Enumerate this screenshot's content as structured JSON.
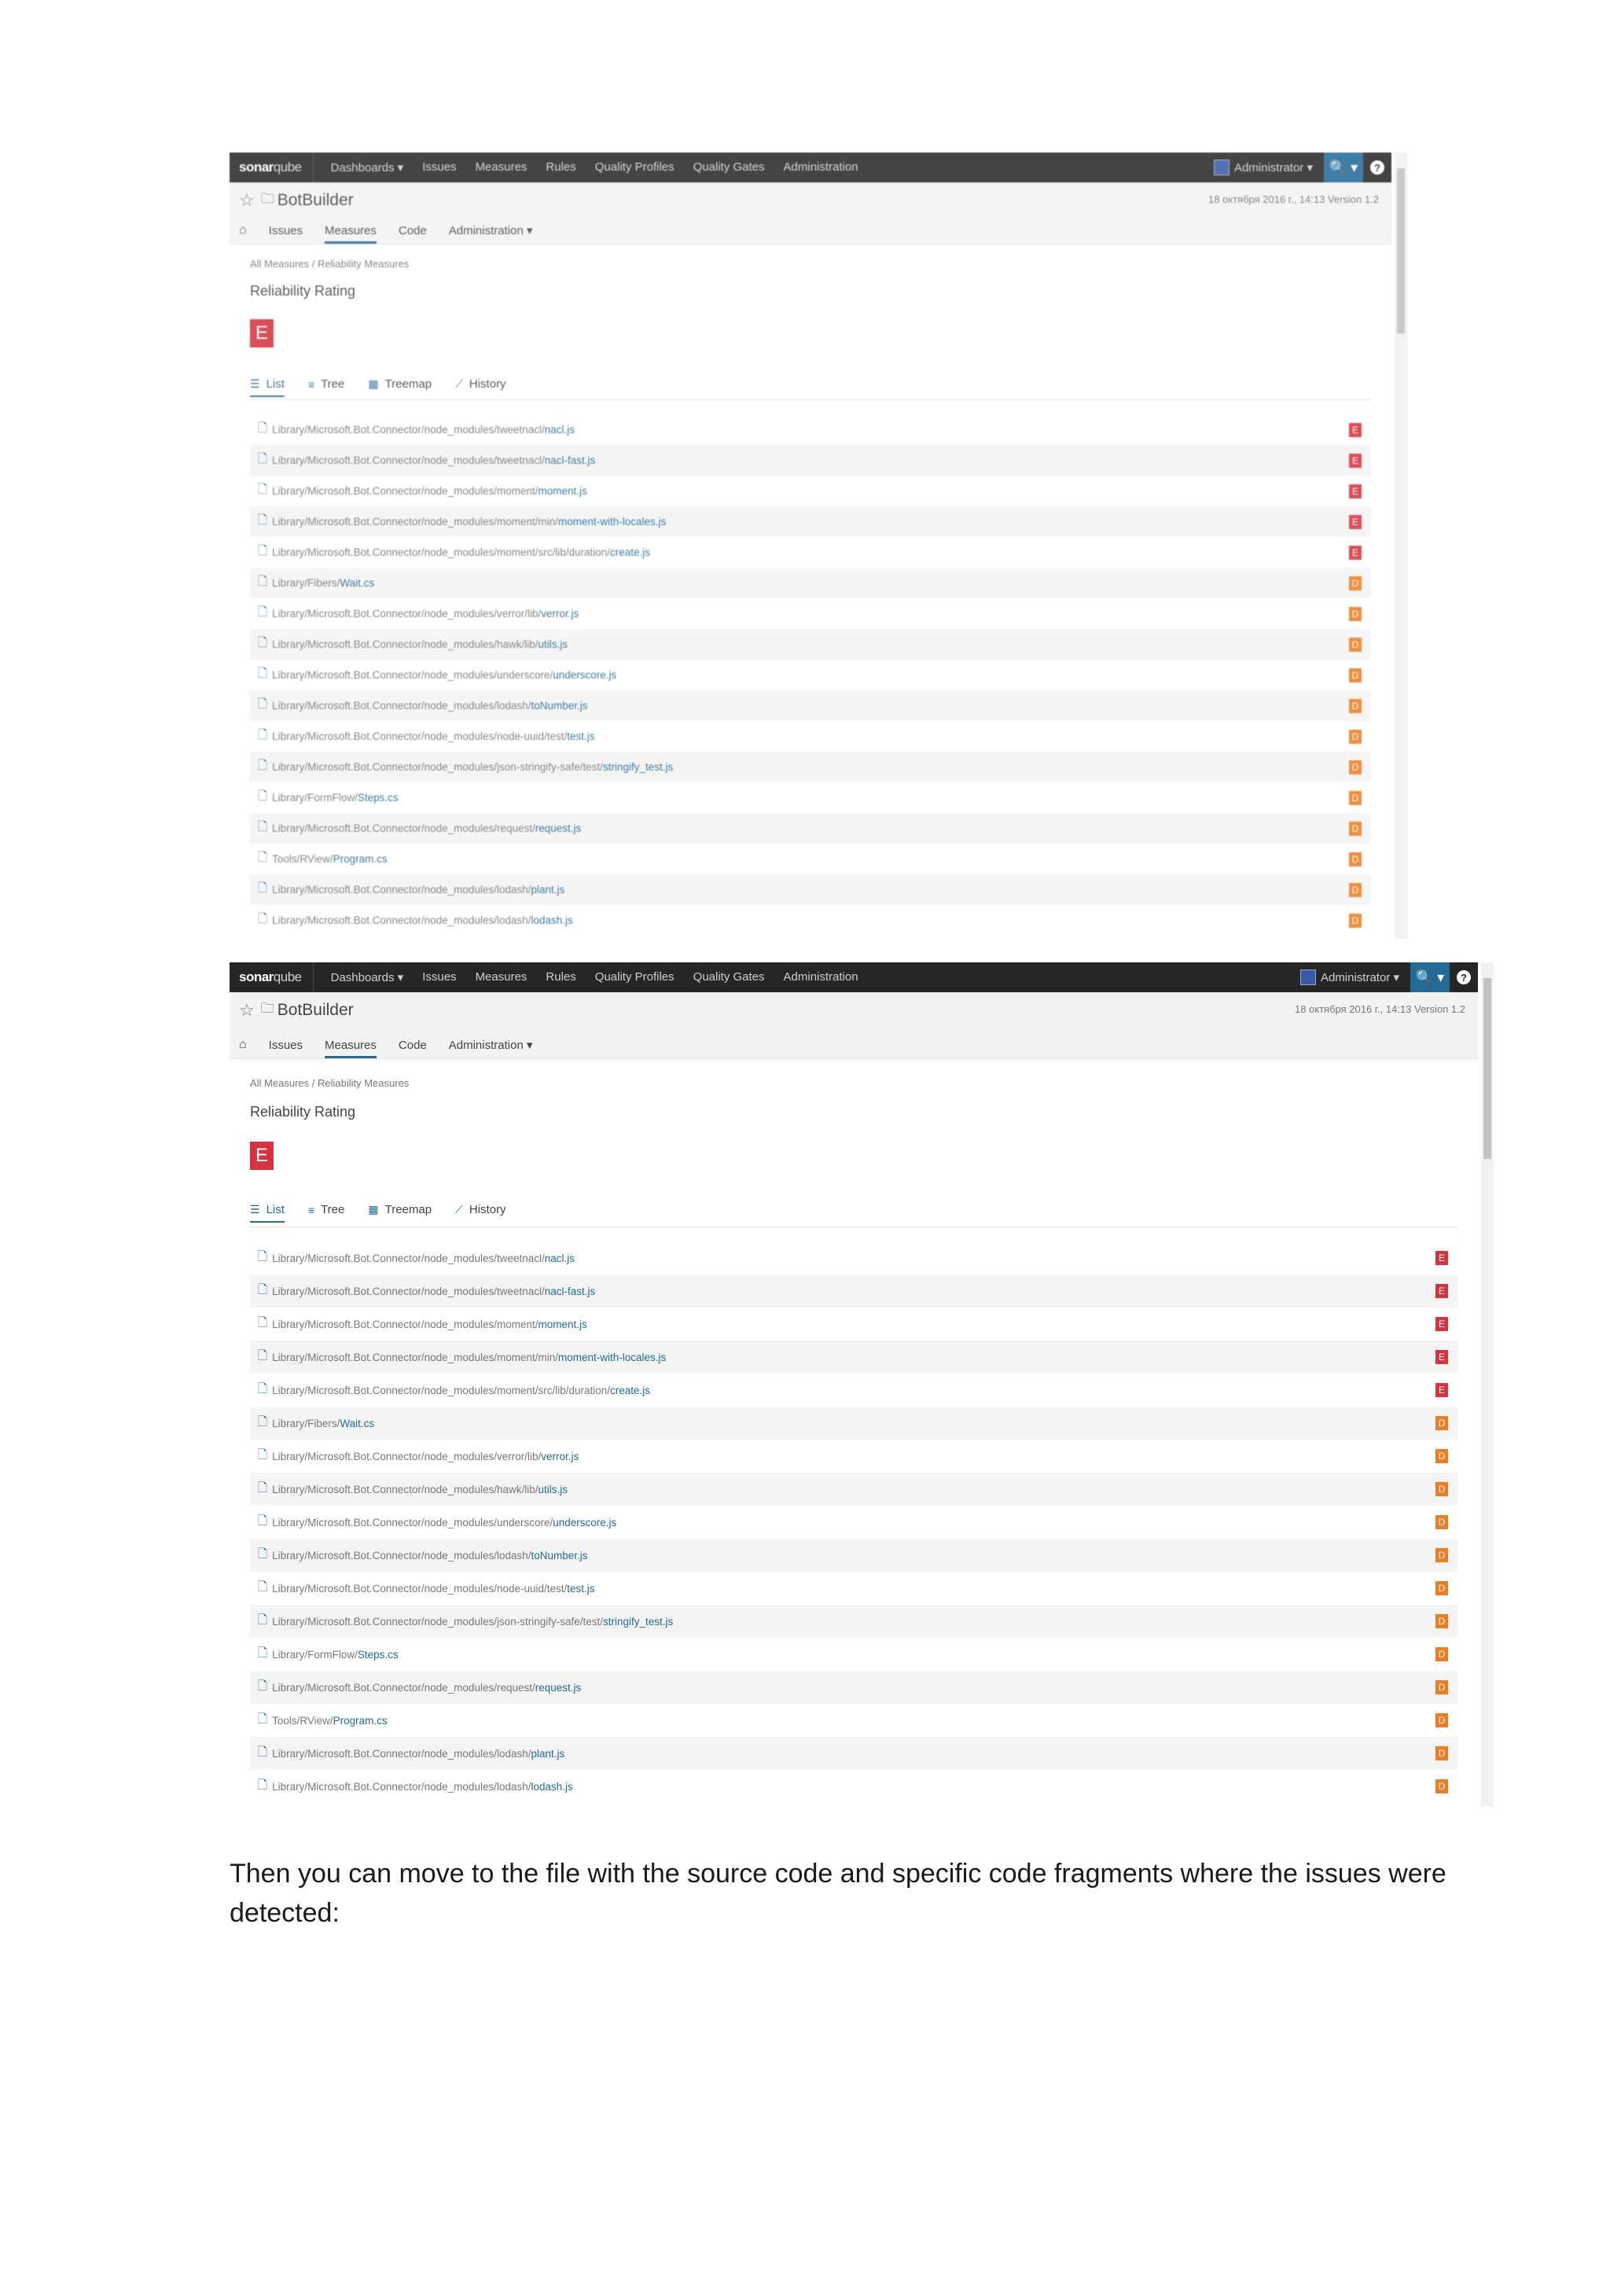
{
  "app": {
    "logo_bold": "sonar",
    "logo_light": "qube",
    "nav": [
      "Dashboards ▾",
      "Issues",
      "Measures",
      "Rules",
      "Quality Profiles",
      "Quality Gates",
      "Administration"
    ],
    "user": "Administrator ▾",
    "search_glyph": "🔍 ▾",
    "help_glyph": "?"
  },
  "project": {
    "name": "BotBuilder",
    "meta": "18 октября 2016 г., 14:13   Version 1.2",
    "tabs": [
      "Issues",
      "Measures",
      "Code",
      "Administration ▾"
    ],
    "active_tab": "Measures"
  },
  "measure": {
    "breadcrumb": "All Measures / Reliability Measures",
    "title": "Reliability Rating",
    "rating": "E",
    "view_tabs": [
      "List",
      "Tree",
      "Treemap",
      "History"
    ],
    "active_view": "List"
  },
  "colors": {
    "rating_E": "#d4333f",
    "rating_D": "#ed7d20",
    "link": "#236a97",
    "navbar": "#262626"
  },
  "files": [
    {
      "dir": "Library/Microsoft.Bot.Connector/node_modules/tweetnacl/",
      "name": "nacl.js",
      "rating": "E"
    },
    {
      "dir": "Library/Microsoft.Bot.Connector/node_modules/tweetnacl/",
      "name": "nacl-fast.js",
      "rating": "E"
    },
    {
      "dir": "Library/Microsoft.Bot.Connector/node_modules/moment/",
      "name": "moment.js",
      "rating": "E"
    },
    {
      "dir": "Library/Microsoft.Bot.Connector/node_modules/moment/min/",
      "name": "moment-with-locales.js",
      "rating": "E"
    },
    {
      "dir": "Library/Microsoft.Bot.Connector/node_modules/moment/src/lib/duration/",
      "name": "create.js",
      "rating": "E"
    },
    {
      "dir": "Library/Fibers/",
      "name": "Wait.cs",
      "rating": "D"
    },
    {
      "dir": "Library/Microsoft.Bot.Connector/node_modules/verror/lib/",
      "name": "verror.js",
      "rating": "D"
    },
    {
      "dir": "Library/Microsoft.Bot.Connector/node_modules/hawk/lib/",
      "name": "utils.js",
      "rating": "D"
    },
    {
      "dir": "Library/Microsoft.Bot.Connector/node_modules/underscore/",
      "name": "underscore.js",
      "rating": "D"
    },
    {
      "dir": "Library/Microsoft.Bot.Connector/node_modules/lodash/",
      "name": "toNumber.js",
      "rating": "D"
    },
    {
      "dir": "Library/Microsoft.Bot.Connector/node_modules/node-uuid/test/",
      "name": "test.js",
      "rating": "D"
    },
    {
      "dir": "Library/Microsoft.Bot.Connector/node_modules/json-stringify-safe/test/",
      "name": "stringify_test.js",
      "rating": "D"
    },
    {
      "dir": "Library/FormFlow/",
      "name": "Steps.cs",
      "rating": "D"
    },
    {
      "dir": "Library/Microsoft.Bot.Connector/node_modules/request/",
      "name": "request.js",
      "rating": "D"
    },
    {
      "dir": "Tools/RView/",
      "name": "Program.cs",
      "rating": "D"
    },
    {
      "dir": "Library/Microsoft.Bot.Connector/node_modules/lodash/",
      "name": "plant.js",
      "rating": "D"
    },
    {
      "dir": "Library/Microsoft.Bot.Connector/node_modules/lodash/",
      "name": "lodash.js",
      "rating": "D"
    }
  ],
  "caption": "Then you can move to the file with the source code and specific code fragments where the issues were detected:"
}
